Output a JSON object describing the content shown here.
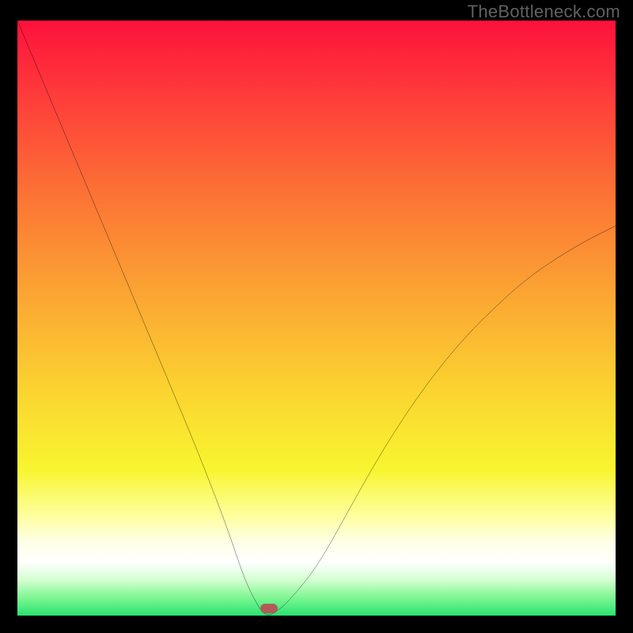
{
  "watermark": "TheBottleneck.com",
  "colors": {
    "frame": "#000000",
    "watermark": "#616161",
    "curve": "#000000",
    "lozenge": "#b25a57",
    "gradient_stops": [
      {
        "offset": 0.0,
        "color": "#fe113b"
      },
      {
        "offset": 0.12,
        "color": "#fe3a3a"
      },
      {
        "offset": 0.28,
        "color": "#fc6f35"
      },
      {
        "offset": 0.45,
        "color": "#fba333"
      },
      {
        "offset": 0.62,
        "color": "#fbd430"
      },
      {
        "offset": 0.75,
        "color": "#f8f52f"
      },
      {
        "offset": 0.83,
        "color": "#feffa1"
      },
      {
        "offset": 0.87,
        "color": "#feffe4"
      },
      {
        "offset": 0.905,
        "color": "#ffffff"
      },
      {
        "offset": 0.935,
        "color": "#d4ffd0"
      },
      {
        "offset": 0.965,
        "color": "#7ef692"
      },
      {
        "offset": 1.0,
        "color": "#19e06b"
      }
    ]
  },
  "chart_data": {
    "type": "line",
    "title": "",
    "xlabel": "",
    "ylabel": "",
    "xlim": [
      0,
      100
    ],
    "ylim": [
      0,
      100
    ],
    "series": [
      {
        "name": "bottleneck-curve",
        "x": [
          0,
          5,
          10,
          15,
          20,
          25,
          30,
          35,
          38,
          40,
          41,
          42,
          43,
          45,
          50,
          55,
          60,
          65,
          70,
          75,
          80,
          85,
          90,
          95,
          100
        ],
        "values": [
          100,
          88,
          76,
          64,
          52,
          40,
          28,
          15,
          6,
          2,
          0.5,
          0,
          0.5,
          2,
          8,
          17,
          26,
          34,
          41,
          47,
          52,
          56.5,
          60,
          63,
          65.5
        ]
      }
    ],
    "annotations": [
      {
        "name": "min-marker",
        "x": 42,
        "y": 1.2
      }
    ]
  }
}
